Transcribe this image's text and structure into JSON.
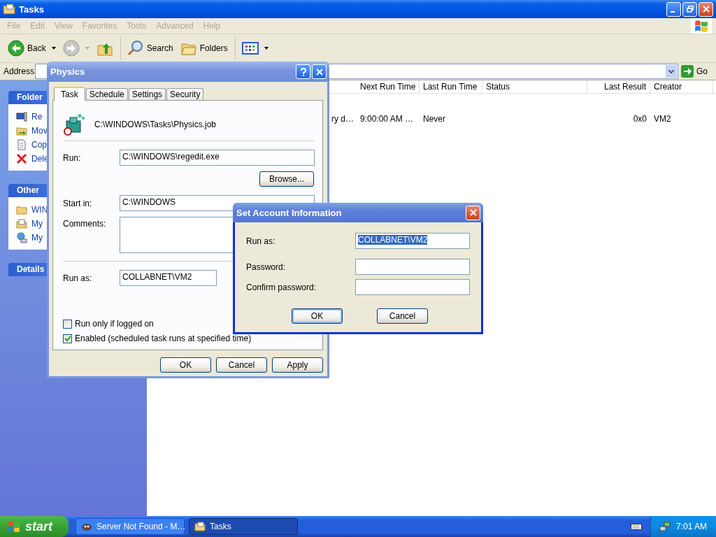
{
  "explorer": {
    "title": "Tasks",
    "menu": [
      "File",
      "Edit",
      "View",
      "Favorites",
      "Tools",
      "Advanced",
      "Help"
    ],
    "toolbar": [
      {
        "kind": "back",
        "label": "Back"
      },
      {
        "kind": "forward"
      },
      {
        "kind": "up"
      },
      {
        "kind": "search",
        "label": "Search"
      },
      {
        "kind": "folders",
        "label": "Folders"
      },
      {
        "kind": "views"
      }
    ],
    "address": {
      "label": "Address",
      "go": "Go"
    },
    "task_pane": [
      {
        "title": "Folder",
        "items": [
          {
            "kind": "rename",
            "label": "Re"
          },
          {
            "kind": "move",
            "label": "Mov"
          },
          {
            "kind": "copy",
            "label": "Cop"
          },
          {
            "kind": "delete",
            "label": "Dele"
          }
        ]
      },
      {
        "title": "Other",
        "items": [
          {
            "kind": "folder",
            "label": "WIN"
          },
          {
            "kind": "documents",
            "label": "My"
          },
          {
            "kind": "network",
            "label": "My"
          }
        ]
      },
      {
        "title": "Details"
      }
    ],
    "list": {
      "columns": [
        "Next Run Time",
        "Last Run Time",
        "Status",
        "Last Result",
        "Creator"
      ],
      "rows": [
        {
          "column_1": "ry d…",
          "cells": [
            "9:00:00 AM …",
            "Never",
            null,
            "0x0",
            "VM2"
          ]
        }
      ]
    }
  },
  "physics": {
    "title": "Physics",
    "tabs": [
      {
        "label": "Task",
        "selected": true
      },
      {
        "label": "Schedule",
        "selected": false
      },
      {
        "label": "Settings",
        "selected": false
      },
      {
        "label": "Security",
        "selected": false
      }
    ],
    "path": "C:\\WINDOWS\\Tasks\\Physics.job",
    "run": {
      "label": "Run:",
      "value": "C:\\WINDOWS\\regedit.exe"
    },
    "browse": "Browse...",
    "start_in": {
      "label": "Start in:",
      "value": "C:\\WINDOWS"
    },
    "comments": {
      "label": "Comments:"
    },
    "run_as": {
      "label": "Run as:",
      "value": "COLLABNET\\VM2"
    },
    "checkboxes": [
      {
        "label": "Run only if logged on",
        "checked": false
      },
      {
        "label": "Enabled (scheduled task runs at specified time)",
        "checked": true
      }
    ],
    "buttons": [
      "OK",
      "Cancel",
      "Apply"
    ]
  },
  "account": {
    "title": "Set Account Information",
    "fields": [
      {
        "label": "Run as:",
        "value": "COLLABNET\\VM2",
        "text_selected": true
      },
      {
        "label": "Password:"
      },
      {
        "label": "Confirm password:"
      }
    ],
    "buttons": [
      {
        "label": "OK",
        "default": true
      },
      {
        "label": "Cancel",
        "default": false
      }
    ]
  },
  "taskbar": {
    "start": "start",
    "buttons": [
      {
        "kind": "browser",
        "label": "Server Not Found - M…",
        "selected": false
      },
      {
        "kind": "tasks",
        "label": "Tasks",
        "selected": true
      }
    ],
    "clock": "7:01 AM"
  }
}
